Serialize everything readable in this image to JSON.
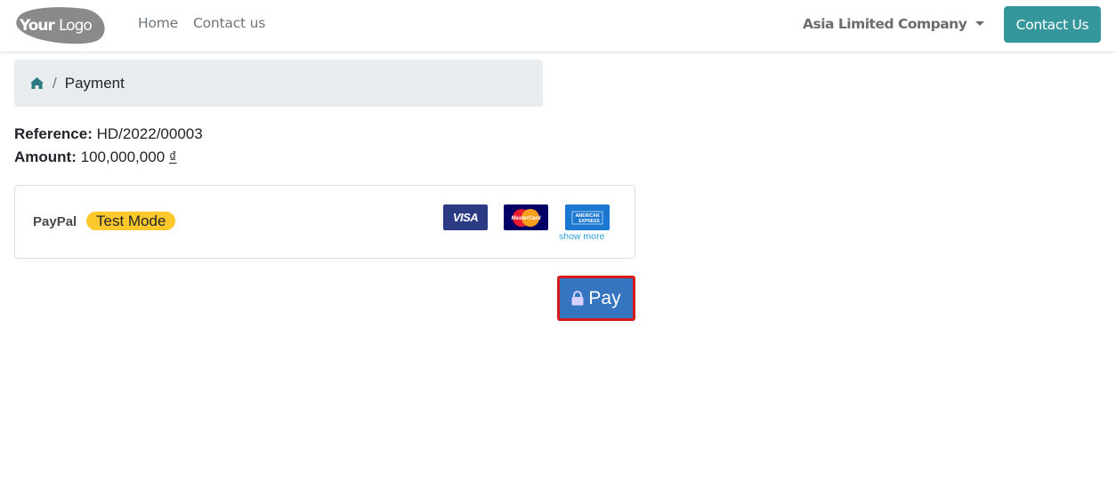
{
  "navbar": {
    "logo_text_bold": "Your",
    "logo_text_light": "Logo",
    "links": [
      {
        "label": "Home"
      },
      {
        "label": "Contact us"
      }
    ],
    "company": "Asia Limited Company",
    "contact_button": "Contact Us"
  },
  "breadcrumb": {
    "home_icon": "home-icon",
    "separator": "/",
    "current": "Payment"
  },
  "details": {
    "reference_label": "Reference:",
    "reference_value": "HD/2022/00003",
    "amount_label": "Amount:",
    "amount_value": "100,000,000",
    "currency_symbol": "₫"
  },
  "payment_method": {
    "provider": "PayPal",
    "badge": "Test Mode",
    "cards": [
      {
        "name": "visa",
        "label": "VISA"
      },
      {
        "name": "mastercard",
        "label": "MasterCard"
      },
      {
        "name": "amex",
        "label": "AMERICAN EXPRESS"
      }
    ],
    "show_more": "show more"
  },
  "pay_button": {
    "icon": "lock-icon",
    "label": "Pay"
  },
  "colors": {
    "brand_teal": "#35979c",
    "pay_blue": "#3575c0",
    "highlight_red": "#d61b1b",
    "badge_yellow": "#ffc82c"
  }
}
